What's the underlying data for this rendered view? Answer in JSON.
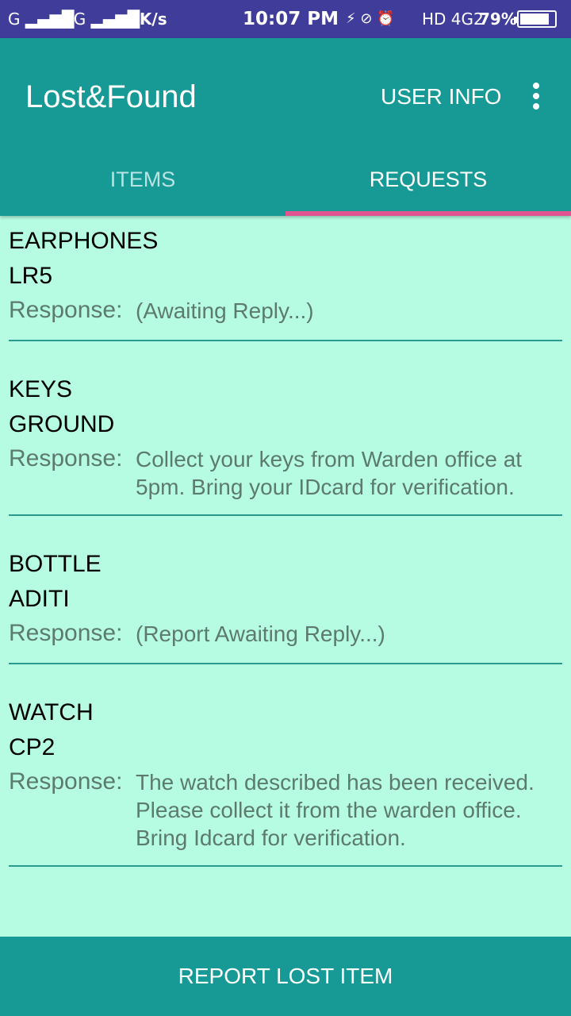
{
  "status_bar": {
    "signal1": "G ▂▄▆█",
    "signal2": "4G ▂▄▆█",
    "network_speed": "0K/s",
    "time": "10:07 PM",
    "icons": "⚡ ⊘ ⏰",
    "hd": "HD 4G2",
    "battery": "79%"
  },
  "app_bar": {
    "title": "Lost&Found",
    "user_info": "USER INFO"
  },
  "tabs": [
    {
      "label": "ITEMS"
    },
    {
      "label": "REQUESTS"
    }
  ],
  "requests": [
    {
      "item": "EARPHONES",
      "location": "LR5",
      "response_label": "Response:",
      "response": "(Awaiting Reply...)"
    },
    {
      "item": "KEYS",
      "location": "GROUND",
      "response_label": "Response:",
      "response": "Collect your keys from Warden office at 5pm. Bring your IDcard for verification."
    },
    {
      "item": "BOTTLE",
      "location": "ADITI",
      "response_label": "Response:",
      "response": "(Report Awaiting Reply...)"
    },
    {
      "item": "WATCH",
      "location": "CP2",
      "response_label": "Response:",
      "response": "The watch described has been received. Please collect it from the warden office. Bring Idcard for verification."
    }
  ],
  "report_button": "REPORT LOST ITEM",
  "colors": {
    "status_bar": "#3f3d99",
    "primary": "#179a95",
    "accent": "#e0548f",
    "background": "#b6fce3"
  }
}
